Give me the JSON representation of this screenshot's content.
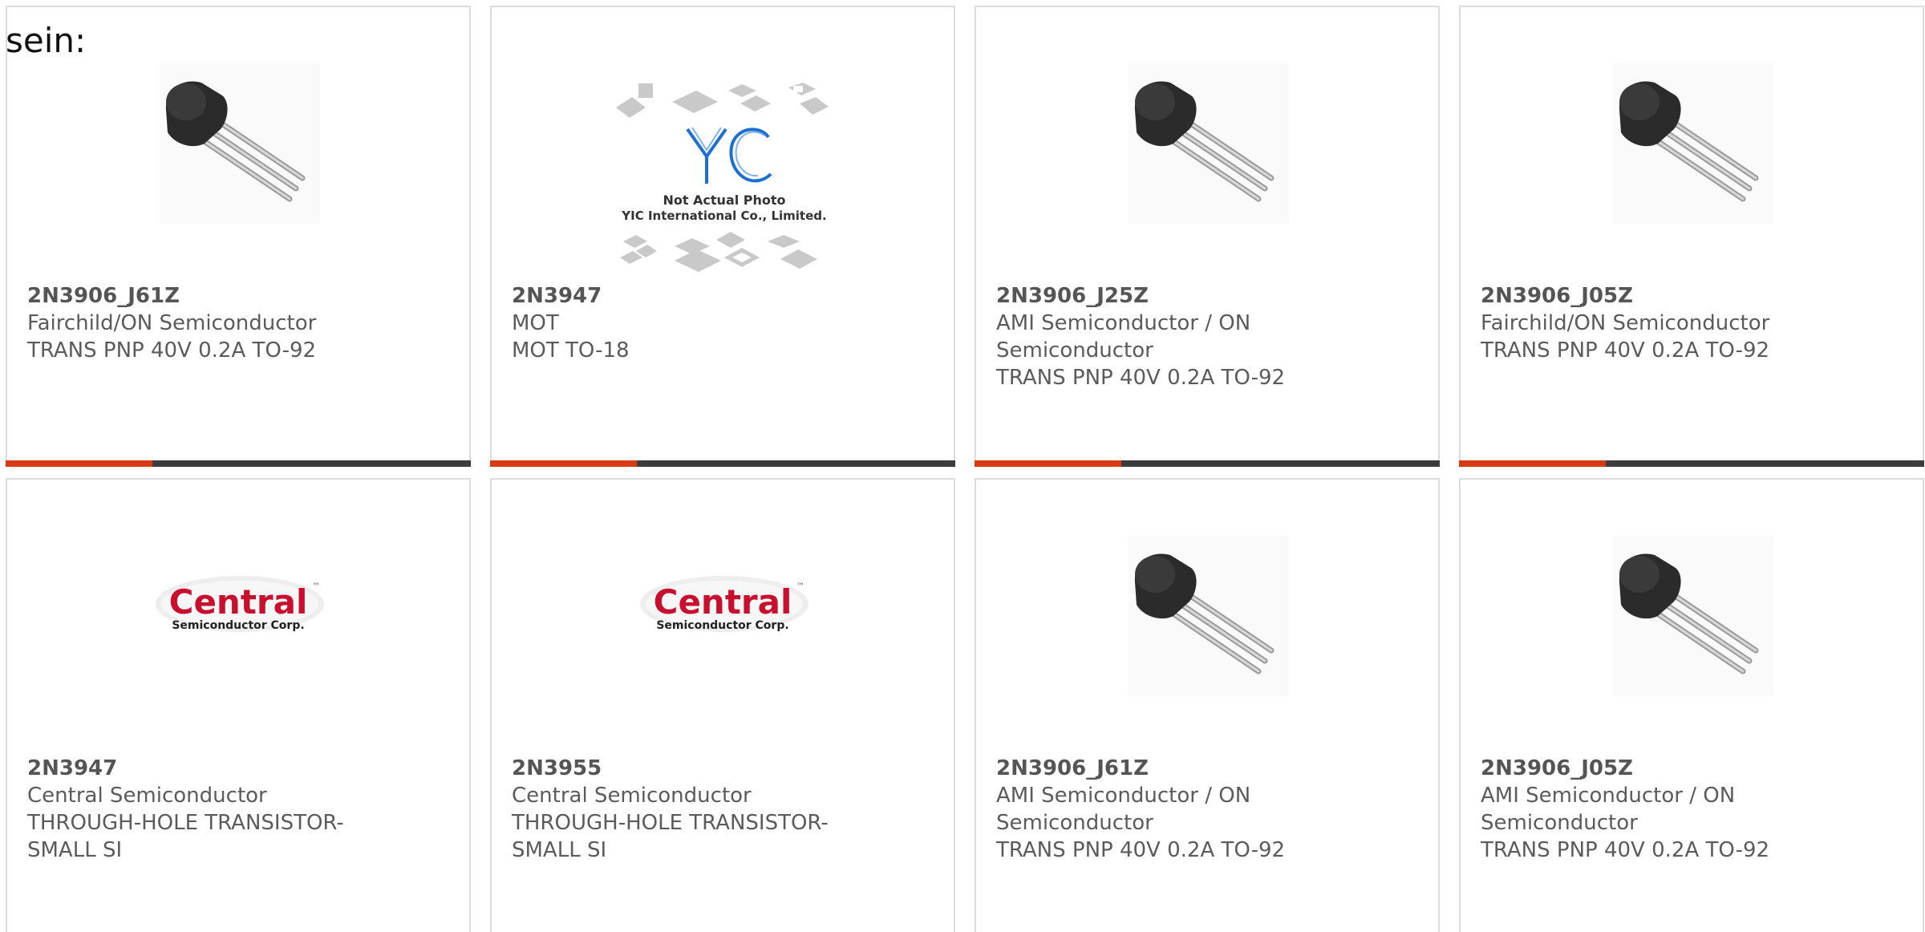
{
  "heading": "sein:",
  "colors": {
    "accent": "#d83a16",
    "bar": "#3c3c3c",
    "border": "#dcdcdc",
    "text": "#5b5b5b",
    "logo_red": "#c8102e"
  },
  "cards": [
    {
      "image": "to92-transistor-photo",
      "part": "2N3906_J61Z",
      "manufacturer": "Fairchild/ON Semiconductor",
      "description": "TRANS PNP 40V 0.2A TO-92"
    },
    {
      "image": "yic-not-actual-photo",
      "image_text_1": "Not Actual Photo",
      "image_text_2": "YIC International Co., Limited.",
      "logo_text": "YIC",
      "part": "2N3947",
      "manufacturer": "MOT",
      "description": "MOT TO-18"
    },
    {
      "image": "to92-transistor-photo",
      "part": "2N3906_J25Z",
      "manufacturer": "AMI Semiconductor / ON Semiconductor",
      "description": "TRANS PNP 40V 0.2A TO-92"
    },
    {
      "image": "to92-transistor-photo",
      "part": "2N3906_J05Z",
      "manufacturer": "Fairchild/ON Semiconductor",
      "description": "TRANS PNP 40V 0.2A TO-92"
    },
    {
      "image": "central-semiconductor-logo",
      "logo_text": "Central",
      "logo_tm": "™",
      "logo_subtext": "Semiconductor Corp.",
      "part": "2N3947",
      "manufacturer": "Central Semiconductor",
      "description": "THROUGH-HOLE TRANSISTOR-SMALL SI"
    },
    {
      "image": "central-semiconductor-logo",
      "logo_text": "Central",
      "logo_tm": "™",
      "logo_subtext": "Semiconductor Corp.",
      "part": "2N3955",
      "manufacturer": "Central Semiconductor",
      "description": "THROUGH-HOLE TRANSISTOR-SMALL SI"
    },
    {
      "image": "to92-transistor-photo",
      "part": "2N3906_J61Z",
      "manufacturer": "AMI Semiconductor / ON Semiconductor",
      "description": "TRANS PNP 40V 0.2A TO-92"
    },
    {
      "image": "to92-transistor-photo",
      "part": "2N3906_J05Z",
      "manufacturer": "AMI Semiconductor / ON Semiconductor",
      "description": "TRANS PNP 40V 0.2A TO-92"
    }
  ]
}
